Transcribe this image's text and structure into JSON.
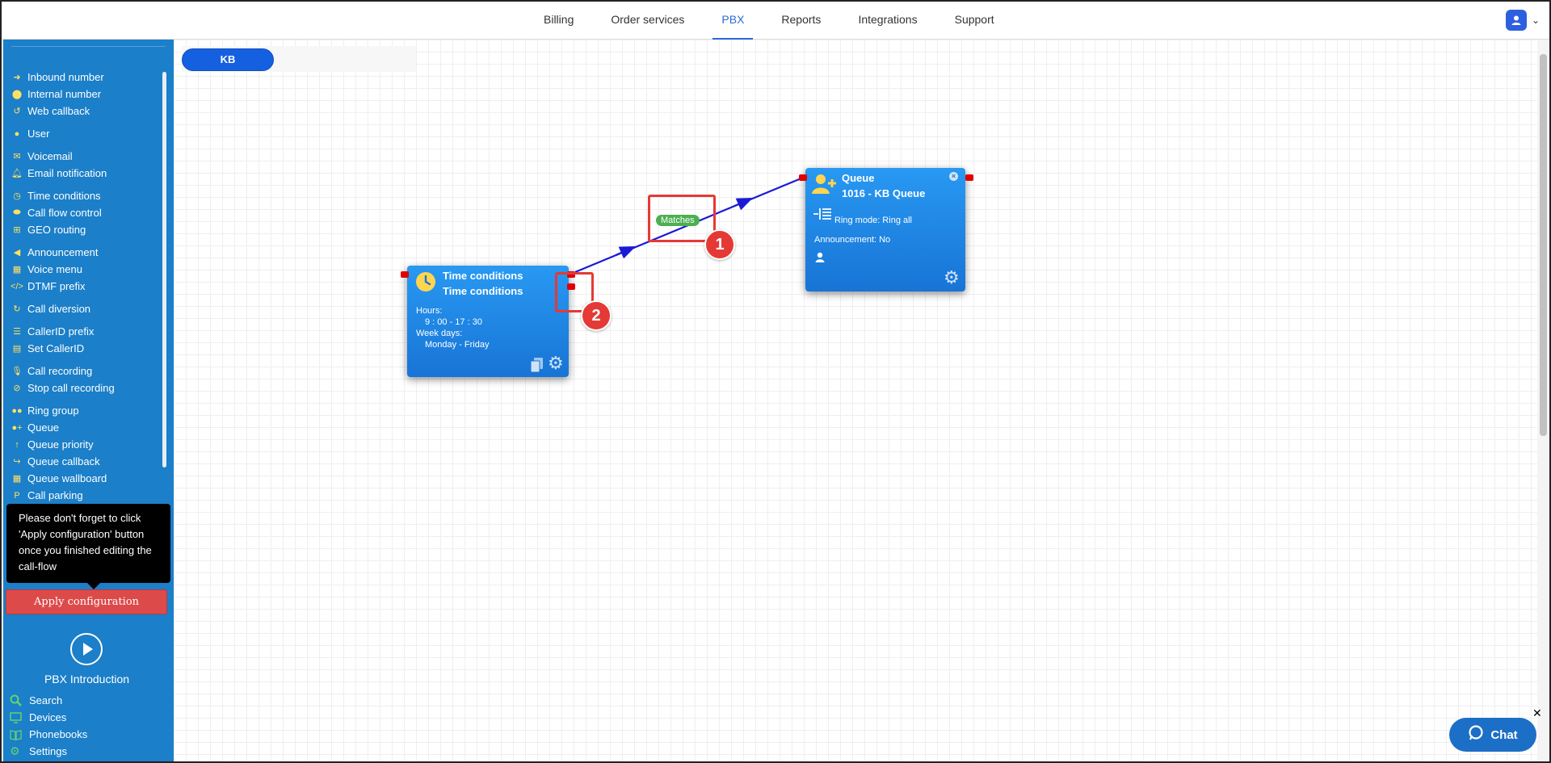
{
  "topnav": {
    "items": [
      {
        "label": "Billing",
        "active": false
      },
      {
        "label": "Order services",
        "active": false
      },
      {
        "label": "PBX",
        "active": true
      },
      {
        "label": "Reports",
        "active": false
      },
      {
        "label": "Integrations",
        "active": false
      },
      {
        "label": "Support",
        "active": false
      }
    ]
  },
  "sidebar": {
    "items": [
      {
        "label": "Inbound number",
        "icon": "arrow-circle-icon"
      },
      {
        "label": "Internal number",
        "icon": "map-pin-icon"
      },
      {
        "label": "Web callback",
        "icon": "refresh-icon"
      },
      {
        "label": "User",
        "icon": "user-icon"
      },
      {
        "label": "Voicemail",
        "icon": "envelope-icon"
      },
      {
        "label": "Email notification",
        "icon": "bell-icon"
      },
      {
        "label": "Time conditions",
        "icon": "clock-icon"
      },
      {
        "label": "Call flow control",
        "icon": "toggle-icon"
      },
      {
        "label": "GEO routing",
        "icon": "sitemap-icon"
      },
      {
        "label": "Announcement",
        "icon": "megaphone-icon"
      },
      {
        "label": "Voice menu",
        "icon": "grid-icon"
      },
      {
        "label": "DTMF prefix",
        "icon": "code-icon"
      },
      {
        "label": "Call diversion",
        "icon": "redo-icon"
      },
      {
        "label": "CallerID prefix",
        "icon": "list-icon"
      },
      {
        "label": "Set CallerID",
        "icon": "id-card-icon"
      },
      {
        "label": "Call recording",
        "icon": "microphone-icon"
      },
      {
        "label": "Stop call recording",
        "icon": "microphone-slash-icon"
      },
      {
        "label": "Ring group",
        "icon": "users-icon"
      },
      {
        "label": "Queue",
        "icon": "user-plus-icon"
      },
      {
        "label": "Queue priority",
        "icon": "arrow-up-icon"
      },
      {
        "label": "Queue callback",
        "icon": "share-icon"
      },
      {
        "label": "Queue wallboard",
        "icon": "table-icon"
      },
      {
        "label": "Call parking",
        "icon": "parking-icon"
      }
    ],
    "tooltip": "Please don't forget to click 'Apply configuration' button once you finished editing the call-flow",
    "apply_label": "Apply configuration",
    "intro_label": "PBX Introduction",
    "bottom_items": [
      {
        "label": "Search",
        "icon": "search-icon"
      },
      {
        "label": "Devices",
        "icon": "monitor-icon"
      },
      {
        "label": "Phonebooks",
        "icon": "book-icon"
      },
      {
        "label": "Settings",
        "icon": "gear-icon"
      }
    ]
  },
  "canvas": {
    "flow_tab": "KB",
    "time_node": {
      "title1": "Time conditions",
      "title2": "Time conditions",
      "hours_label": "Hours:",
      "hours_value": "9 : 00 - 17 : 30",
      "days_label": "Week days:",
      "days_value": "Monday - Friday"
    },
    "queue_node": {
      "title1": "Queue",
      "title2": "1016 - KB Queue",
      "ring_mode": "Ring mode: Ring all",
      "announcement": "Announcement: No"
    },
    "edge_label": "Matches",
    "badge1": "1",
    "badge2": "2"
  },
  "chat": {
    "label": "Chat"
  },
  "colors": {
    "sidebar": "#1b7fc9",
    "node": "#1e88e5",
    "accent": "#2b6bd6",
    "apply": "#dd4a4a",
    "highlight": "#e53935",
    "edge": "#1a1ad6",
    "match": "#4caf50"
  }
}
